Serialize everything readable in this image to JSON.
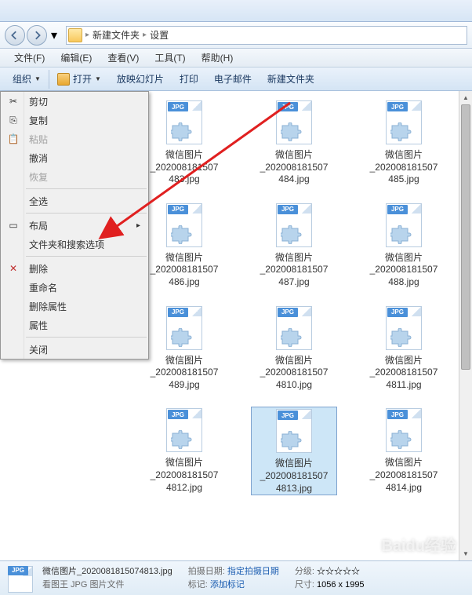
{
  "breadcrumb": {
    "root_icon": "folder",
    "parts": [
      "新建文件夹",
      "设置"
    ]
  },
  "menubar": [
    {
      "label": "文件(F)"
    },
    {
      "label": "编辑(E)"
    },
    {
      "label": "查看(V)"
    },
    {
      "label": "工具(T)"
    },
    {
      "label": "帮助(H)"
    }
  ],
  "toolbar": {
    "organize": "组织",
    "open": "打开",
    "slideshow": "放映幻灯片",
    "print": "打印",
    "email": "电子邮件",
    "new_folder": "新建文件夹"
  },
  "context_menu": {
    "cut": "剪切",
    "copy": "复制",
    "paste": "粘贴",
    "undo": "撤消",
    "redo": "恢复",
    "select_all": "全选",
    "layout": "布局",
    "folder_search_options": "文件夹和搜索选项",
    "delete": "删除",
    "rename": "重命名",
    "remove_props": "删除属性",
    "properties": "属性",
    "close": "关闭"
  },
  "files": [
    {
      "name_l1": "微信图片",
      "name_l2": "_202008181507",
      "name_l3": "483.jpg"
    },
    {
      "name_l1": "微信图片",
      "name_l2": "_202008181507",
      "name_l3": "484.jpg"
    },
    {
      "name_l1": "微信图片",
      "name_l2": "_202008181507",
      "name_l3": "485.jpg"
    },
    {
      "name_l1": "微信图片",
      "name_l2": "_202008181507",
      "name_l3": "486.jpg"
    },
    {
      "name_l1": "微信图片",
      "name_l2": "_202008181507",
      "name_l3": "487.jpg"
    },
    {
      "name_l1": "微信图片",
      "name_l2": "_202008181507",
      "name_l3": "488.jpg"
    },
    {
      "name_l1": "微信图片",
      "name_l2": "_202008181507",
      "name_l3": "489.jpg"
    },
    {
      "name_l1": "微信图片",
      "name_l2": "_202008181507",
      "name_l3": "4810.jpg"
    },
    {
      "name_l1": "微信图片",
      "name_l2": "_202008181507",
      "name_l3": "4811.jpg"
    },
    {
      "name_l1": "微信图片",
      "name_l2": "_202008181507",
      "name_l3": "4812.jpg"
    },
    {
      "name_l1": "微信图片",
      "name_l2": "_202008181507",
      "name_l3": "4813.jpg",
      "selected": true
    },
    {
      "name_l1": "微信图片",
      "name_l2": "_202008181507",
      "name_l3": "4814.jpg"
    }
  ],
  "badge_text": "JPG",
  "details": {
    "filename": "微信图片_2020081815074813.jpg",
    "subtitle": "看图王 JPG 图片文件",
    "date_label": "拍摄日期:",
    "date_val": "指定拍摄日期",
    "rating_label": "分级:",
    "rating_val": "☆☆☆☆☆",
    "tags_label": "标记:",
    "tags_val": "添加标记",
    "size_label": "尺寸:",
    "size_val": "1056 x 1995"
  },
  "watermark": "Baidu经验"
}
